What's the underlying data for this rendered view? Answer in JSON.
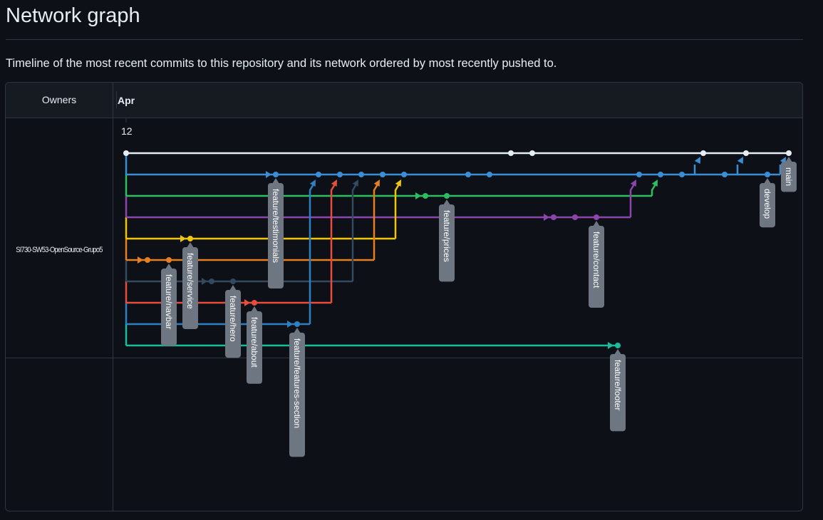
{
  "title": "Network graph",
  "description": "Timeline of the most recent commits to this repository and its network ordered by most recently pushed to.",
  "header": {
    "owners_label": "Owners",
    "month": "Apr",
    "day": "12"
  },
  "owner": "SI730-SW53-OpenSource-Grupo5",
  "lanes": [
    {
      "row": 0,
      "color": "#e6edf3",
      "commits": [
        0,
        18,
        19,
        27,
        29,
        31
      ],
      "label": "main",
      "label_at": 31
    },
    {
      "row": 1,
      "color": "#3b8ed6",
      "commits": [
        7,
        9,
        10,
        11,
        12,
        13,
        16,
        17,
        24,
        25,
        26,
        28,
        30
      ],
      "label": "develop",
      "label_at": 30,
      "extra_label": "feature/testimonials",
      "extra_label_at": 7,
      "merges_main": [
        [
          26,
          27
        ],
        [
          28,
          29
        ],
        [
          30,
          31
        ]
      ]
    },
    {
      "row": 2,
      "color": "#2ebd5f",
      "commits": [
        14,
        15
      ],
      "merge_into": 25,
      "label": "feature/prices",
      "label_at": 15
    },
    {
      "row": 3,
      "color": "#8e44ad",
      "commits": [
        20,
        21,
        22
      ],
      "merge_into": 24,
      "label": "feature/contact",
      "label_at": 22
    },
    {
      "row": 4,
      "color": "#f1c40f",
      "commits": [
        3
      ],
      "merge_into": 13,
      "label": "feature/service",
      "label_at": 3
    },
    {
      "row": 5,
      "color": "#e67e22",
      "commits": [
        1,
        2
      ],
      "merge_into": 12,
      "label": "feature/navbar",
      "label_at": 2
    },
    {
      "row": 6,
      "color": "#34495e",
      "commits": [
        4,
        5
      ],
      "merge_into": 11,
      "label": "feature/hero",
      "label_at": 5
    },
    {
      "row": 7,
      "color": "#e74c3c",
      "commits": [
        6
      ],
      "merge_into": 10,
      "label": "feature/about",
      "label_at": 6
    },
    {
      "row": 8,
      "color": "#2f80c2",
      "commits": [
        8
      ],
      "merge_into": 9,
      "label": "feature/features-section",
      "label_at": 8
    },
    {
      "row": 9,
      "color": "#1abc9c",
      "commits": [
        23
      ],
      "label": "feature/footer",
      "label_at": 23
    }
  ]
}
